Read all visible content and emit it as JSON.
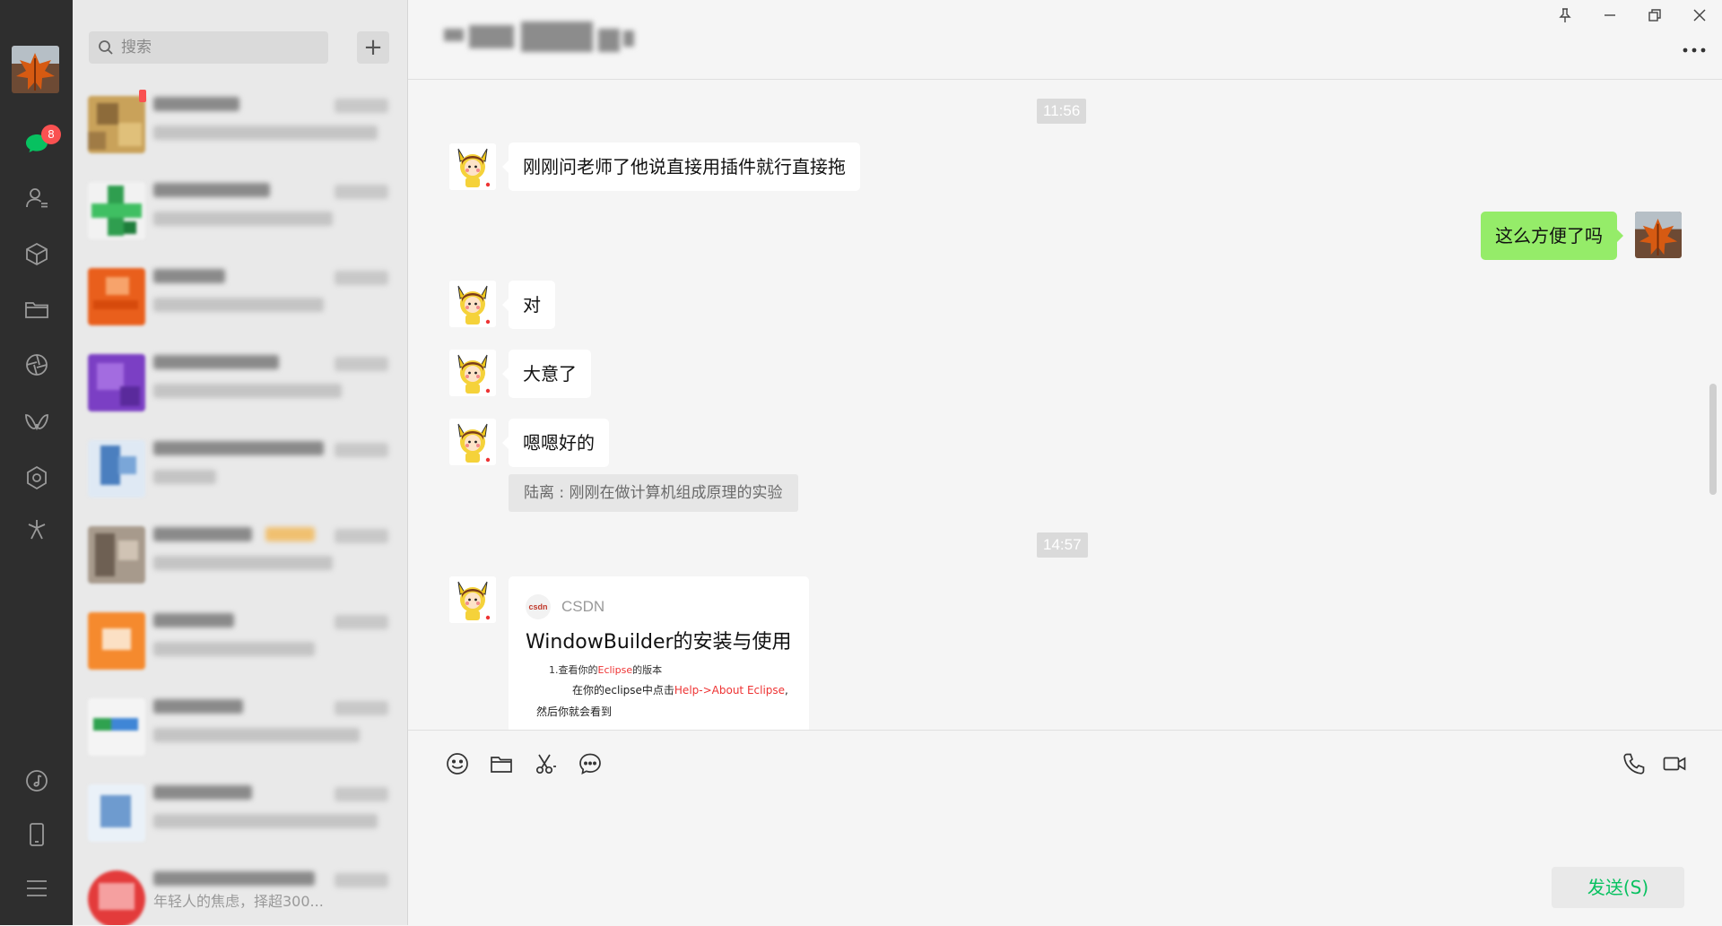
{
  "colors": {
    "rail": "#2e2e2e",
    "list_bg": "#e9e9e9",
    "chat_bg": "#f5f5f5",
    "outgoing_bubble": "#95ec69",
    "send_text": "#07c160",
    "badge": "#fa5151"
  },
  "sidebar": {
    "icons": [
      "chat-icon",
      "contacts-icon",
      "favorites-icon",
      "files-icon",
      "moments-icon",
      "channels-icon",
      "mini-programs-icon",
      "search-discover-icon",
      "music-icon",
      "phone-icon",
      "menu-icon"
    ],
    "unread_badge": "8"
  },
  "search": {
    "placeholder": "搜索",
    "add_label": "+"
  },
  "conversation_list": {
    "bottom_snippet": "年轻人的焦虑，择超300..."
  },
  "window_controls": [
    "pin-icon",
    "minimize-icon",
    "maximize-icon",
    "close-icon"
  ],
  "messages": [
    {
      "type": "time",
      "text": "11:56"
    },
    {
      "type": "incoming",
      "text": "刚刚问老师了他说直接用插件就行直接拖"
    },
    {
      "type": "outgoing",
      "text": "这么方便了吗"
    },
    {
      "type": "incoming",
      "text": "对"
    },
    {
      "type": "incoming",
      "text": "大意了"
    },
    {
      "type": "incoming",
      "text": "嗯嗯好的"
    },
    {
      "type": "quote",
      "text": "陆离 : 刚刚在做计算机组成原理的实验"
    },
    {
      "type": "time",
      "text": "14:57"
    },
    {
      "type": "link_card",
      "source_logo": "csdn",
      "source_name": "CSDN",
      "title": "WindowBuilder的安装与使用",
      "preview_line1_a": "1.查看你的",
      "preview_line1_b": "Eclipse",
      "preview_line1_c": "的版本",
      "preview_line2_a": "在你的eclipse中点击",
      "preview_line2_b": "Help->About Eclipse",
      "preview_line2_c": ",",
      "preview_line3": "然后你就会看到"
    }
  ],
  "composer": {
    "tools": [
      "emoji-icon",
      "folder-icon",
      "screenshot-icon",
      "chat-history-icon"
    ],
    "call_tools": [
      "voice-call-icon",
      "video-call-icon"
    ],
    "send_label": "发送(S)"
  }
}
